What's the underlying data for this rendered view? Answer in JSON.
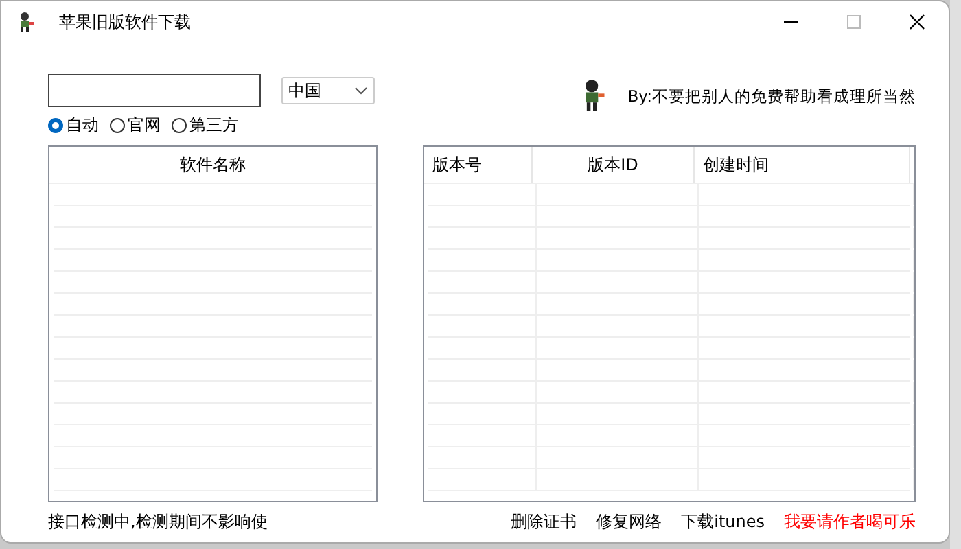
{
  "window": {
    "title": "苹果旧版软件下载"
  },
  "region": {
    "value": "中国"
  },
  "author_note": "By:不要把别人的免费帮助看成理所当然",
  "sources": [
    {
      "label": "自动",
      "selected": true
    },
    {
      "label": "官网",
      "selected": false
    },
    {
      "label": "第三方",
      "selected": false
    }
  ],
  "software_list": {
    "columns": [
      "软件名称"
    ]
  },
  "version_table": {
    "columns": [
      "版本号",
      "版本ID",
      "创建时间"
    ]
  },
  "status_bar": {
    "message": "接口检测中,检测期间不影响使",
    "links": [
      {
        "label": "删除证书",
        "kind": "normal"
      },
      {
        "label": "修复网络",
        "kind": "normal"
      },
      {
        "label": "下载itunes",
        "kind": "normal"
      },
      {
        "label": "我要请作者喝可乐",
        "kind": "highlight"
      }
    ]
  }
}
